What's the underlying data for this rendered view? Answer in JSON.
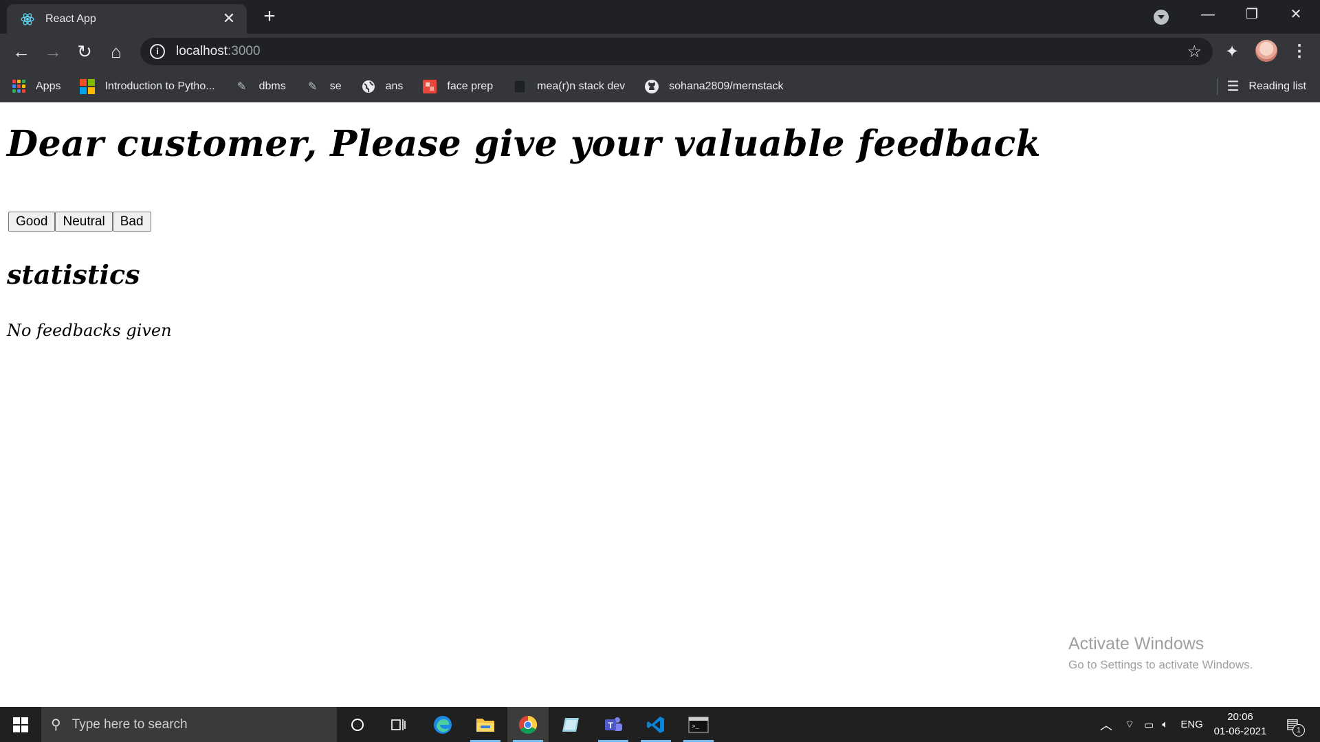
{
  "browser": {
    "tab": {
      "title": "React App",
      "favicon": "react-logo-icon",
      "close_label": "✕"
    },
    "new_tab_label": "+",
    "window_controls": {
      "minimize": "—",
      "maximize": "❐",
      "close": "✕"
    },
    "toolbar": {
      "back": "←",
      "forward": "→",
      "reload": "↻",
      "home": "⌂",
      "url_host": "localhost",
      "url_port": ":3000",
      "bookmark_star": "☆",
      "extensions": "✦",
      "menu": "⋮"
    },
    "bookmarks": [
      {
        "label": "Apps",
        "icon": "apps-grid-icon"
      },
      {
        "label": "Introduction to Pytho...",
        "icon": "microsoft-logo-icon"
      },
      {
        "label": "dbms",
        "icon": "bookmark-glyph-icon"
      },
      {
        "label": "se",
        "icon": "bookmark-glyph-icon"
      },
      {
        "label": "ans",
        "icon": "globe-icon"
      },
      {
        "label": "face prep",
        "icon": "face-prep-icon"
      },
      {
        "label": "mea(r)n stack dev",
        "icon": "blank-page-icon"
      },
      {
        "label": "sohana2809/mernstack",
        "icon": "github-icon"
      }
    ],
    "reading_list": "Reading list"
  },
  "page": {
    "heading": "Dear customer, Please give your valuable feedback",
    "buttons": {
      "good": "Good",
      "neutral": "Neutral",
      "bad": "Bad"
    },
    "statistics_heading": "statistics",
    "empty_message": "No feedbacks given"
  },
  "watermark": {
    "title": "Activate Windows",
    "subtitle": "Go to Settings to activate Windows."
  },
  "taskbar": {
    "search_placeholder": "Type here to search",
    "apps": [
      "cortana-icon",
      "task-view-icon",
      "edge-icon",
      "file-explorer-icon",
      "chrome-icon",
      "notes-icon",
      "teams-icon",
      "vscode-icon",
      "terminal-icon"
    ],
    "tray": {
      "language": "ENG"
    },
    "clock": {
      "time": "20:06",
      "date": "01-06-2021"
    },
    "notifications_count": "1"
  }
}
